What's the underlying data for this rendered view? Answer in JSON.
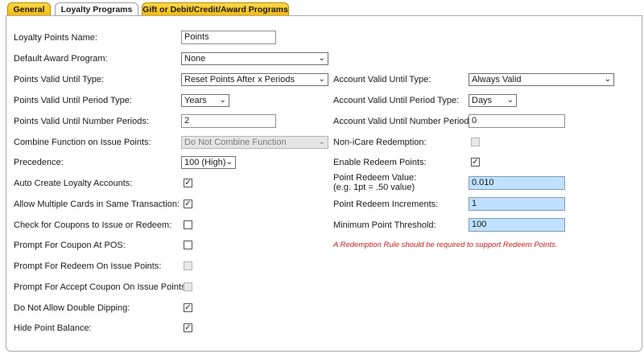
{
  "tabs": [
    {
      "label": "General"
    },
    {
      "label": "Loyalty Programs"
    },
    {
      "label": "Gift or Debit/Credit/Award Programs"
    }
  ],
  "left": {
    "points_name": {
      "label": "Loyalty Points Name:",
      "value": "Points"
    },
    "default_award": {
      "label": "Default Award Program:",
      "value": "None"
    },
    "valid_until_type": {
      "label": "Points Valid Until Type:",
      "value": "Reset Points After x Periods"
    },
    "valid_period_type": {
      "label": "Points Valid Until Period Type:",
      "value": "Years"
    },
    "valid_number_periods": {
      "label": "Points Valid Until Number Periods:",
      "value": "2"
    },
    "combine_function": {
      "label": "Combine Function on Issue Points:",
      "value": "Do Not Combine Function"
    },
    "precedence": {
      "label": "Precedence:",
      "value": "100 (High)"
    },
    "auto_create": {
      "label": "Auto Create Loyalty Accounts:",
      "checked": true
    },
    "allow_multiple": {
      "label": "Allow Multiple Cards in Same Transaction:",
      "checked": true
    },
    "check_coupons": {
      "label": "Check for Coupons to Issue or Redeem:",
      "checked": false
    },
    "prompt_coupon": {
      "label": "Prompt For Coupon At POS:",
      "checked": false
    },
    "prompt_redeem": {
      "label": "Prompt For Redeem On Issue Points:",
      "checked": false
    },
    "prompt_accept": {
      "label": "Prompt For Accept Coupon On Issue Points:",
      "checked": false
    },
    "no_double_dip": {
      "label": "Do Not Allow Double Dipping:",
      "checked": true
    },
    "hide_balance": {
      "label": "Hide Point Balance:",
      "checked": true
    }
  },
  "right": {
    "account_valid_type": {
      "label": "Account Valid Until Type:",
      "value": "Always Valid"
    },
    "account_period_type": {
      "label": "Account Valid Until Period Type:",
      "value": "Days"
    },
    "account_number_periods": {
      "label": "Account Valid Until Number Periods:",
      "value": "0"
    },
    "non_icare": {
      "label": "Non-iCare Redemption:",
      "checked": false
    },
    "enable_redeem": {
      "label": "Enable Redeem Points:",
      "checked": true
    },
    "redeem_value": {
      "label1": "Point Redeem Value:",
      "label2": "(e.g. 1pt = .50 value)",
      "value": "0.010"
    },
    "redeem_increments": {
      "label": "Point Redeem Increments:",
      "value": "1"
    },
    "min_threshold": {
      "label": "Minimum Point Threshold:",
      "value": "100"
    },
    "note": "A Redemption Rule should be required to support Redeem Points."
  },
  "glyphs": {
    "check": "✓",
    "arrow": "⌄"
  }
}
